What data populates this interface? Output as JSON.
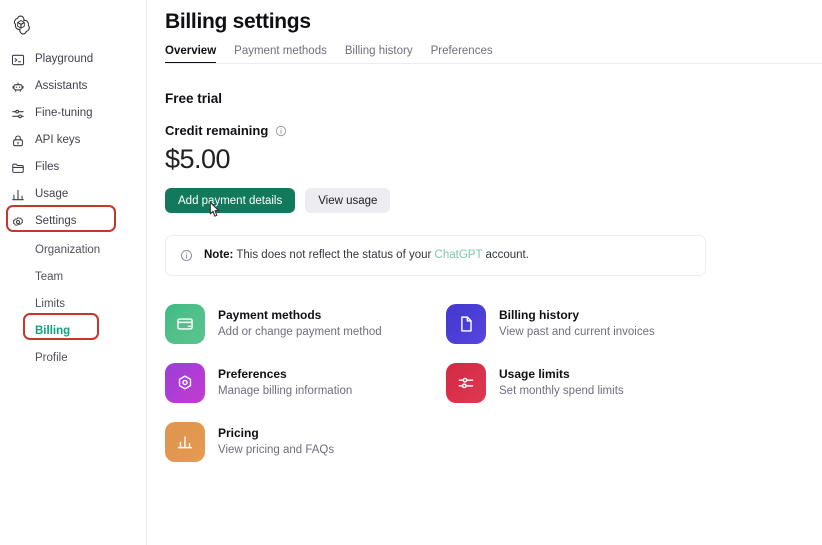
{
  "brand": {
    "logo_name": "openai-logo"
  },
  "sidebar": {
    "items": [
      {
        "label": "Playground",
        "icon": "terminal-icon"
      },
      {
        "label": "Assistants",
        "icon": "robot-icon"
      },
      {
        "label": "Fine-tuning",
        "icon": "sliders-icon"
      },
      {
        "label": "API keys",
        "icon": "lock-icon"
      },
      {
        "label": "Files",
        "icon": "folder-icon"
      },
      {
        "label": "Usage",
        "icon": "bar-chart-icon"
      },
      {
        "label": "Settings",
        "icon": "gear-icon"
      }
    ],
    "subitems": [
      {
        "label": "Organization",
        "active": false
      },
      {
        "label": "Team",
        "active": false
      },
      {
        "label": "Limits",
        "active": false
      },
      {
        "label": "Billing",
        "active": true
      },
      {
        "label": "Profile",
        "active": false
      }
    ],
    "active_color": "#10a37f",
    "active_pill_bg": "#e7f4ef"
  },
  "annotations": {
    "color": "#c0392b",
    "boxes": [
      {
        "target": "Settings"
      },
      {
        "target": "Billing"
      }
    ]
  },
  "header": {
    "title": "Billing settings"
  },
  "tabs": [
    {
      "label": "Overview",
      "active": true
    },
    {
      "label": "Payment methods",
      "active": false
    },
    {
      "label": "Billing history",
      "active": false
    },
    {
      "label": "Preferences",
      "active": false
    }
  ],
  "overview": {
    "plan_title": "Free trial",
    "credit_label": "Credit remaining",
    "credit_info_icon": "info-circle-icon",
    "credit_amount": "$5.00",
    "primary_button": "Add payment details",
    "secondary_button": "View usage",
    "primary_button_color": "#12795c",
    "cursor_icon": "mouse-pointer-icon"
  },
  "note": {
    "icon": "info-circle-icon",
    "bold_prefix": "Note:",
    "text_before": " This does not reflect the status of your ",
    "link_text": "ChatGPT",
    "link_color": "#7cc6ad",
    "text_after": " account."
  },
  "cards": [
    {
      "title": "Payment methods",
      "desc": "Add or change payment method",
      "icon": "credit-card-icon",
      "color": "#4cbd88"
    },
    {
      "title": "Billing history",
      "desc": "View past and current invoices",
      "icon": "document-icon",
      "color": "#4b3ed6"
    },
    {
      "title": "Preferences",
      "desc": "Manage billing information",
      "icon": "gear-hex-icon",
      "color": "#b03cd6"
    },
    {
      "title": "Usage limits",
      "desc": "Set monthly spend limits",
      "icon": "sliders-icon",
      "color": "#d9304b"
    },
    {
      "title": "Pricing",
      "desc": "View pricing and FAQs",
      "icon": "bar-chart-icon",
      "color": "#e2974f"
    }
  ]
}
